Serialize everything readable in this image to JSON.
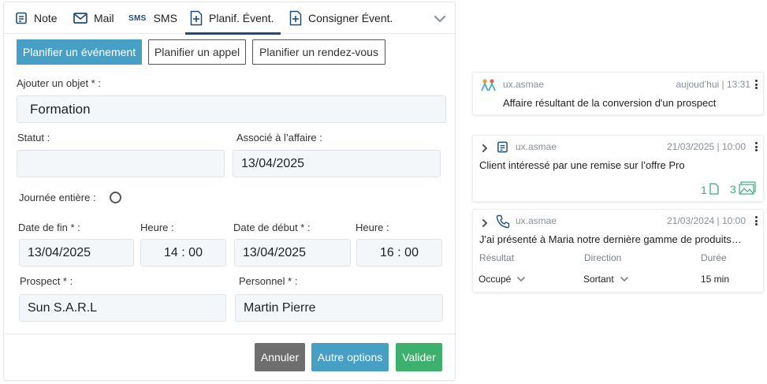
{
  "tabs": [
    {
      "label": "Note",
      "icon": "note-icon"
    },
    {
      "label": "Mail",
      "icon": "mail-icon"
    },
    {
      "label": "SMS",
      "icon": "sms-icon",
      "icon_text": "SMS"
    },
    {
      "label": "Planif. Évent.",
      "icon": "calendar-plus-icon"
    },
    {
      "label": "Consigner Évent.",
      "icon": "calendar-plus-icon"
    }
  ],
  "event_types": [
    "Planifier un événement",
    "Planifier un appel",
    "Planifier un rendez-vous"
  ],
  "form": {
    "object_label": "Ajouter un objet * :",
    "object_value": "Formation",
    "status_label": "Statut :",
    "status_value": "",
    "affair_label": "Associé à l’affaire :",
    "affair_value": "13/04/2025",
    "allday_label": "Journée entière :",
    "end_date_label": "Date de fin * :",
    "end_date_value": "13/04/2025",
    "end_time_label": "Heure :",
    "end_time_value": "14 : 00",
    "start_date_label": "Date de début * :",
    "start_date_value": "13/04/2025",
    "start_time_label": "Heure :",
    "start_time_value": "16 : 00",
    "prospect_label": "Prospect * :",
    "prospect_value": "Sun S.A.R.L",
    "staff_label": "Personnel * :",
    "staff_value": "Martin Pierre"
  },
  "actions": {
    "cancel": "Annuler",
    "more": "Autre options",
    "submit": "Valider"
  },
  "colors": {
    "primary": "#46a0c6",
    "cancel": "#6e6e6e",
    "submit": "#3db06e",
    "accent": "#1f4d7a",
    "green": "#3aaa7e"
  },
  "feed": [
    {
      "user": "ux.asmae",
      "date": "aujoud’hui | 13:31",
      "text": "Affaire résultant de la conversion d'un prospect",
      "icon": "people-icon"
    },
    {
      "user": "ux.asmae",
      "date": "21/03/2025 | 10:00",
      "text": "Client intéressé par une remise sur l’offre Pro",
      "icon": "note-icon",
      "files_count": "1",
      "images_count": "3"
    },
    {
      "user": "ux.asmae",
      "date": "21/03/2024 | 10:00",
      "text": "J'ai présenté à Maria notre dernière gamme de produits…",
      "icon": "phone-icon",
      "columns": {
        "result_label": "Résultat",
        "result_value": "Occupé",
        "direction_label": "Direction",
        "direction_value": "Sortant",
        "duration_label": "Durée",
        "duration_value": "15 min"
      }
    }
  ]
}
